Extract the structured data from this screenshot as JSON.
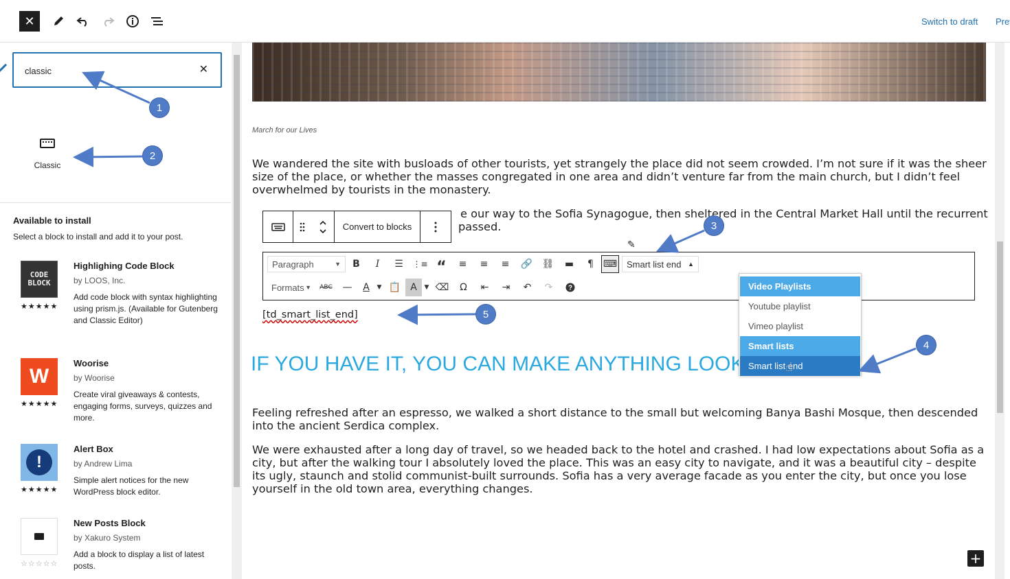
{
  "topbar": {
    "close_icon": "close-icon",
    "switch_to_draft": "Switch to draft",
    "preview": "Prev"
  },
  "sidebar": {
    "search": {
      "value": "classic"
    },
    "result": {
      "label": "Classic"
    },
    "install": {
      "title": "Available to install",
      "subtitle": "Select a block to install and add it to your post.",
      "plugins": [
        {
          "name": "Highlighing Code Block",
          "author": "by LOOS, Inc.",
          "description": "Add code block with syntax highlighting using prism.js. (Available for Gutenberg and Classic Editor)",
          "stars": "★★★★★",
          "thumb_text": "CODE BLOCK"
        },
        {
          "name": "Woorise",
          "author": "by Woorise",
          "description": "Create viral giveaways & contests, engaging forms, surveys, quizzes and more.",
          "stars": "★★★★★",
          "thumb_text": "W"
        },
        {
          "name": "Alert Box",
          "author": "by Andrew Lima",
          "description": "Simple alert notices for the new WordPress block editor.",
          "stars": "★★★★★",
          "thumb_text": "!"
        },
        {
          "name": "New Posts Block",
          "author": "by Xakuro System",
          "description": "Add a block to display a list of latest posts.",
          "stars": "☆☆☆☆☆"
        }
      ]
    }
  },
  "content": {
    "caption": "March for our Lives",
    "para1": "We wandered the site with busloads of other tourists, yet strangely the place did not seem crowded. I’m not sure if it was the sheer size of the place, or whether the masses congregated in one area and didn’t venture far from the main church, but I didn’t feel overwhelmed by tourists in the monastery.",
    "para2_visible": "e our way to the Sofia Synagogue, then sheltered in the Central Market Hall until the recurrent",
    "para2_line2": "passed.",
    "block_toolbar": {
      "convert": "Convert to blocks"
    },
    "classic_toolbar": {
      "paragraph_select": "Paragraph",
      "formats": "Formats",
      "smart_list_select": "Smart list end"
    },
    "dropdown": {
      "items": [
        "Video Playlists",
        "Youtube playlist",
        "Vimeo playlist",
        "Smart lists",
        "Smart list end"
      ]
    },
    "shortcode": "[td_smart_list_end]",
    "heading": "IF YOU HAVE IT, YOU CAN MAKE ANYTHING LOOK GOOD",
    "para3": "Feeling refreshed after an espresso, we walked a short distance to the small but welcoming Banya Bashi Mosque, then descended into the ancient Serdica complex.",
    "para4": "We were exhausted after a long day of travel, so we headed back to the hotel and crashed. I had low expectations about Sofia as a city, but after the walking tour I absolutely loved the place. This was an easy city to navigate, and it was a beautiful city – despite its ugly, staunch and stolid communist-built surrounds. Sofia has a very average facade as you enter the city, but once you lose yourself in the old town area, everything changes."
  },
  "annotations": [
    "1",
    "2",
    "3",
    "4",
    "5"
  ],
  "colors": {
    "accent": "#2271b1",
    "annotation": "#4f7bc7",
    "heading": "#29a9e0",
    "dropdown_header": "#4daae8",
    "dropdown_selected": "#2b7bc4"
  }
}
